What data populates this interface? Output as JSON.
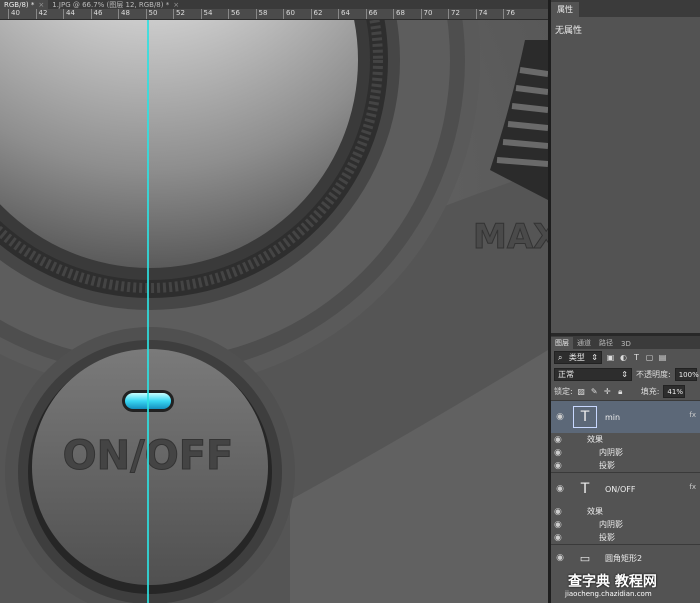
{
  "doc_tabs": [
    {
      "label": "RGB/8) *",
      "close": "×",
      "active": true
    },
    {
      "label": "1.JPG @ 66.7% (图层 12, RGB/8) *",
      "close": "×",
      "active": false
    }
  ],
  "ruler": [
    "40",
    "42",
    "44",
    "46",
    "48",
    "50",
    "52",
    "54",
    "56",
    "58",
    "60",
    "62",
    "64",
    "66",
    "68",
    "70",
    "72",
    "74",
    "76"
  ],
  "canvas": {
    "knob_label": "ON/OFF",
    "max_label": "MAX"
  },
  "properties": {
    "tab": "属性",
    "body": "无属性"
  },
  "layers_panel": {
    "tabs": [
      "图层",
      "通道",
      "路径",
      "3D"
    ],
    "filter_kind": "类型",
    "blend_mode": "正常",
    "opacity_label": "不透明度:",
    "opacity_value": "100%",
    "lock_label": "锁定:",
    "fill_label": "填充:",
    "fill_value": "41%",
    "layers": [
      {
        "name": "min",
        "type_glyph": "T",
        "effects_label": "效果",
        "effects": [
          "内阴影",
          "投影"
        ]
      },
      {
        "name": "ON/OFF",
        "type_glyph": "T",
        "effects_label": "效果",
        "effects": [
          "内阴影",
          "投影"
        ]
      },
      {
        "name": "圆角矩形2",
        "type_glyph": "▭"
      }
    ]
  },
  "watermark": {
    "line1": "查字典 教程网",
    "line2": "jiaocheng.chazidian.com"
  }
}
